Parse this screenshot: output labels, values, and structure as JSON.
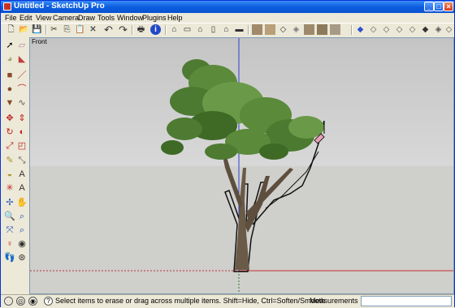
{
  "window": {
    "title": "Untitled - SketchUp Pro"
  },
  "menu": [
    "File",
    "Edit",
    "View",
    "Camera",
    "Draw",
    "Tools",
    "Window",
    "Plugins",
    "Help"
  ],
  "toolbar": {
    "icons": [
      "new-icon",
      "open-icon",
      "save-icon",
      "cut-icon",
      "copy-icon",
      "paste-icon",
      "erase-icon",
      "undo-icon",
      "redo-icon",
      "print-icon",
      "model-info-icon",
      "iso-view-icon",
      "top-view-icon",
      "front-view-icon",
      "right-view-icon",
      "back-view-icon",
      "left-view-icon",
      "xray-icon",
      "back-edges-icon",
      "wireframe-icon",
      "hidden-line-icon",
      "shaded-icon",
      "shaded-textures-icon",
      "monochrome-icon",
      "section-plane-icon",
      "section-cut-icon",
      "section-display-icon",
      "component-icon",
      "iso-box-icon",
      "top-box-icon",
      "front-box-icon",
      "right-box-icon",
      "back-box-icon",
      "left-box-icon",
      "bottom-box-icon"
    ]
  },
  "lefttools": [
    "select-icon",
    "eraser-icon",
    "paint-bucket-icon",
    "eraser-alt-icon",
    "rectangle-icon",
    "line-icon",
    "circle-icon",
    "arc-icon",
    "polygon-icon",
    "freehand-icon",
    "move-icon",
    "push-pull-icon",
    "rotate-icon",
    "follow-me-icon",
    "scale-icon",
    "offset-icon",
    "tape-measure-icon",
    "dimension-icon",
    "protractor-icon",
    "text-icon",
    "axes-icon",
    "3d-text-icon",
    "orbit-icon",
    "pan-icon",
    "zoom-icon",
    "zoom-window-icon",
    "zoom-extents-icon",
    "previous-view-icon",
    "position-camera-icon",
    "look-around-icon",
    "walk-icon",
    "section-plane-tool-icon"
  ],
  "viewport": {
    "view_label": "Front"
  },
  "status": {
    "hint": "Select items to erase or drag across multiple items. Shift=Hide, Ctrl=Soften/Smooth",
    "measurements_label": "Measurements",
    "measurements_value": ""
  }
}
